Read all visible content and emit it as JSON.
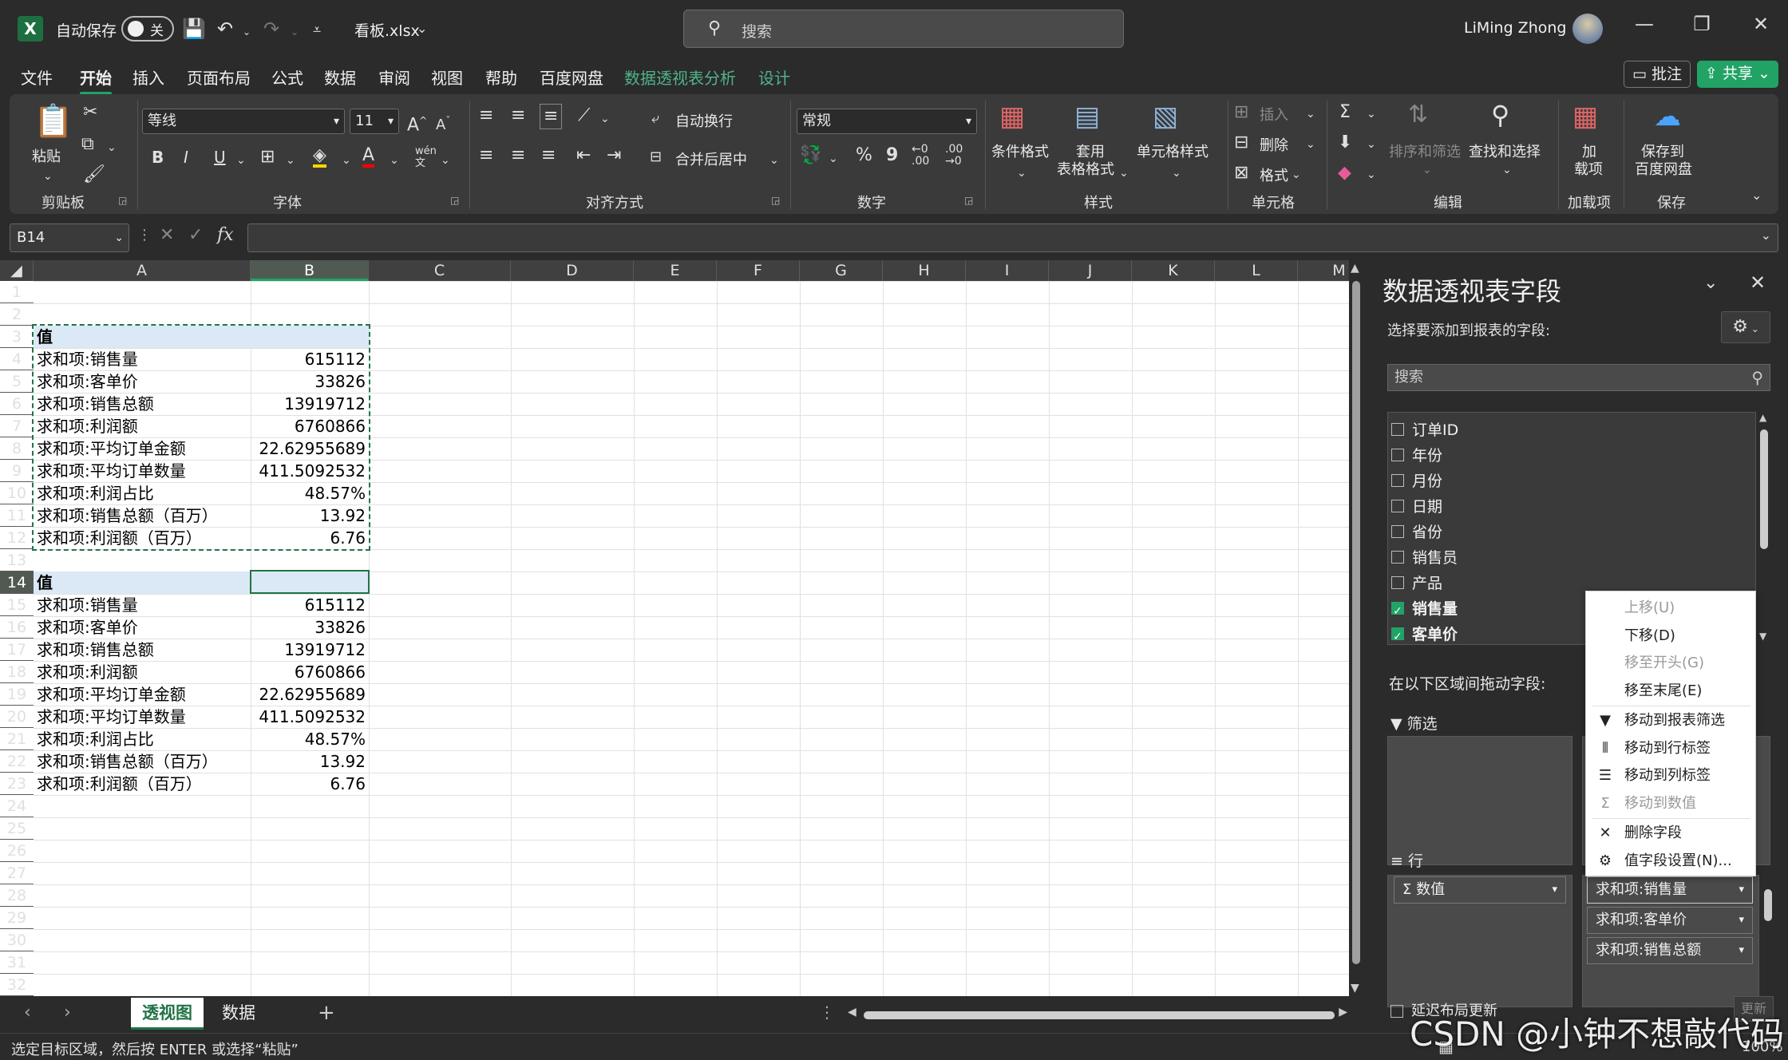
{
  "titlebar": {
    "autosave_label": "自动保存",
    "autosave_state": "关",
    "filename": "看板.xlsx",
    "search_placeholder": "搜索",
    "user_name": "LiMing Zhong"
  },
  "menu": {
    "items": [
      "文件",
      "开始",
      "插入",
      "页面布局",
      "公式",
      "数据",
      "审阅",
      "视图",
      "帮助",
      "百度网盘",
      "数据透视表分析",
      "设计"
    ],
    "active": "开始",
    "comment_btn": "批注",
    "share_btn": "共享"
  },
  "ribbon": {
    "clipboard": {
      "paste": "粘贴",
      "label": "剪贴板"
    },
    "font": {
      "name": "等线",
      "size": "11",
      "label": "字体",
      "bold": "B",
      "italic": "I",
      "underline": "U"
    },
    "alignment": {
      "wrap": "自动换行",
      "merge": "合并后居中",
      "label": "对齐方式"
    },
    "number": {
      "format": "常规",
      "label": "数字",
      "percent": "%",
      "comma": "9"
    },
    "styles": {
      "conditional": "条件格式",
      "table_line1": "套用",
      "table_line2": "表格格式",
      "cell": "单元格样式",
      "label": "样式"
    },
    "cells": {
      "insert": "插入",
      "delete": "删除",
      "format": "格式",
      "label": "单元格"
    },
    "editing": {
      "sort": "排序和筛选",
      "find": "查找和选择",
      "label": "编辑"
    },
    "addins": {
      "addin_line1": "加",
      "addin_line2": "载项",
      "label": "加载项"
    },
    "save": {
      "baidu_line1": "保存到",
      "baidu_line2": "百度网盘",
      "label": "保存"
    }
  },
  "formula_bar": {
    "name_box": "B14",
    "fx": "fx",
    "value": ""
  },
  "sheet": {
    "columns": [
      "A",
      "B",
      "C",
      "D",
      "E",
      "F",
      "G",
      "H",
      "I",
      "J",
      "K",
      "L",
      "M"
    ],
    "rows": [
      "1",
      "2",
      "3",
      "4",
      "5",
      "6",
      "7",
      "8",
      "9",
      "10",
      "11",
      "12",
      "13",
      "14",
      "15",
      "16",
      "17",
      "18",
      "19",
      "20",
      "21",
      "22",
      "23",
      "24",
      "25",
      "26",
      "27",
      "28",
      "29",
      "30",
      "31",
      "32"
    ],
    "pivot1": {
      "header": "值",
      "rows": [
        {
          "label": "求和项:销售量",
          "value": "615112"
        },
        {
          "label": "求和项:客单价",
          "value": "33826"
        },
        {
          "label": "求和项:销售总额",
          "value": "13919712"
        },
        {
          "label": "求和项:利润额",
          "value": "6760866"
        },
        {
          "label": "求和项:平均订单金额",
          "value": "22.62955689"
        },
        {
          "label": "求和项:平均订单数量",
          "value": "411.5092532"
        },
        {
          "label": "求和项:利润占比",
          "value": "48.57%"
        },
        {
          "label": "求和项:销售总额（百万）",
          "value": "13.92"
        },
        {
          "label": "求和项:利润额（百万）",
          "value": "6.76"
        }
      ]
    },
    "pivot2": {
      "header": "值",
      "rows": [
        {
          "label": "求和项:销售量",
          "value": "615112"
        },
        {
          "label": "求和项:客单价",
          "value": "33826"
        },
        {
          "label": "求和项:销售总额",
          "value": "13919712"
        },
        {
          "label": "求和项:利润额",
          "value": "6760866"
        },
        {
          "label": "求和项:平均订单金额",
          "value": "22.62955689"
        },
        {
          "label": "求和项:平均订单数量",
          "value": "411.5092532"
        },
        {
          "label": "求和项:利润占比",
          "value": "48.57%"
        },
        {
          "label": "求和项:销售总额（百万）",
          "value": "13.92"
        },
        {
          "label": "求和项:利润额（百万）",
          "value": "6.76"
        }
      ]
    }
  },
  "tabs": {
    "items": [
      "透视图",
      "数据"
    ],
    "active": "透视图"
  },
  "status": {
    "text": "选定目标区域，然后按 ENTER 或选择“粘贴”",
    "zoom": "100%"
  },
  "pivot_pane": {
    "title": "数据透视表字段",
    "choose_label": "选择要添加到报表的字段:",
    "search_placeholder": "搜索",
    "fields": [
      {
        "name": "订单ID",
        "checked": false
      },
      {
        "name": "年份",
        "checked": false
      },
      {
        "name": "月份",
        "checked": false
      },
      {
        "name": "日期",
        "checked": false
      },
      {
        "name": "省份",
        "checked": false
      },
      {
        "name": "销售员",
        "checked": false
      },
      {
        "name": "产品",
        "checked": false
      },
      {
        "name": "销售量",
        "checked": true
      },
      {
        "name": "客单价",
        "checked": true
      }
    ],
    "drag_label": "在以下区域间拖动字段:",
    "filter_label": "筛选",
    "rows_label": "行",
    "rows_chip": "Σ 数值",
    "value_chips": [
      "求和项:销售量",
      "求和项:客单价",
      "求和项:销售总额"
    ],
    "defer_label": "延迟布局更新",
    "update_btn": "更新"
  },
  "context_menu": {
    "items": [
      {
        "label": "上移(U)",
        "disabled": true,
        "icon": ""
      },
      {
        "label": "下移(D)",
        "disabled": false,
        "icon": ""
      },
      {
        "label": "移至开头(G)",
        "disabled": true,
        "icon": ""
      },
      {
        "label": "移至末尾(E)",
        "disabled": false,
        "icon": ""
      },
      {
        "label": "移动到报表筛选",
        "disabled": false,
        "icon": "filter-icon"
      },
      {
        "label": "移动到行标签",
        "disabled": false,
        "icon": "rows-icon"
      },
      {
        "label": "移动到列标签",
        "disabled": false,
        "icon": "columns-icon"
      },
      {
        "label": "移动到数值",
        "disabled": true,
        "icon": "sigma-icon"
      },
      {
        "label": "删除字段",
        "disabled": false,
        "icon": "close-icon"
      },
      {
        "label": "值字段设置(N)...",
        "disabled": false,
        "icon": "settings-icon"
      }
    ]
  },
  "watermark": "CSDN @小钟不想敲代码",
  "colors": {
    "accent": "#21a366",
    "excel_green": "#217346",
    "header_fill": "#dbe8f6"
  }
}
